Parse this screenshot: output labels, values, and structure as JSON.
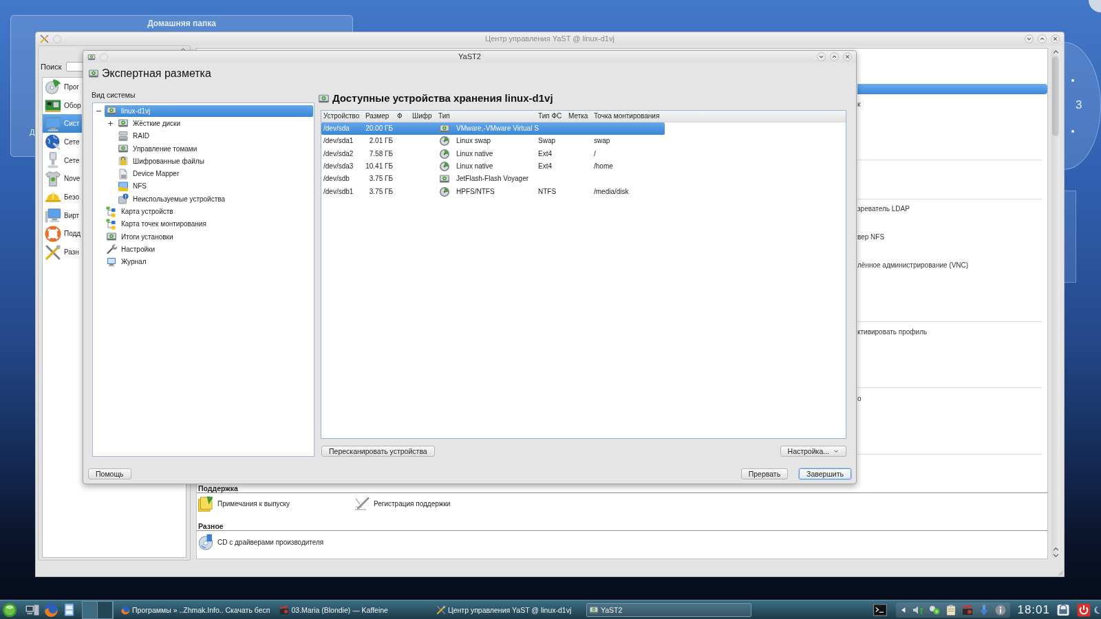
{
  "desktop": {
    "folder_view": {
      "title": "Домашняя папка",
      "items": [
        {
          "label": "Д"
        }
      ]
    },
    "pager": {
      "label": "3"
    }
  },
  "control_center": {
    "title": "Центр управления YaST @ linux-d1vj",
    "search": {
      "label": "Поиск"
    },
    "categories": [
      {
        "label": "Прог",
        "selected": false
      },
      {
        "label": "Обор",
        "selected": false
      },
      {
        "label": "Сист",
        "selected": true
      },
      {
        "label": "Сете",
        "selected": false
      },
      {
        "label": "Сете",
        "selected": false
      },
      {
        "label": "Nove",
        "selected": false
      },
      {
        "label": "Безо",
        "selected": false
      },
      {
        "label": "Вирт",
        "selected": false
      },
      {
        "label": "Подд",
        "selected": false
      },
      {
        "label": "Разн",
        "selected": false
      }
    ],
    "module_column": {
      "header_selected": true,
      "entries": [
        "к",
        "зреватель LDAP",
        "вер NFS",
        "лённое администрирование (VNC)",
        "ктивировать профиль",
        "о"
      ]
    },
    "groups": [
      {
        "heading": "Поддержка",
        "modules": [
          "Примечания к выпуску",
          "Регистрация поддержки"
        ]
      },
      {
        "heading": "Разное",
        "modules": [
          "CD с драйверами производителя"
        ]
      }
    ]
  },
  "dialog": {
    "title": "YaST2",
    "heading": "Экспертная разметка",
    "tree_label": "Вид системы",
    "tree": [
      {
        "label": "linux-d1vj",
        "selected": true,
        "expanded": true,
        "children": [
          {
            "label": "Жёсткие диски",
            "selected": false,
            "expanded": false
          },
          {
            "label": "RAID",
            "selected": false
          },
          {
            "label": "Управление томами",
            "selected": false
          },
          {
            "label": "Шифрованные файлы",
            "selected": false
          },
          {
            "label": "Device Mapper",
            "selected": false
          },
          {
            "label": "NFS",
            "selected": false
          },
          {
            "label": "Неиспользуемые устройства",
            "selected": false
          }
        ]
      },
      {
        "label": "Карта устройств",
        "selected": false
      },
      {
        "label": "Карта точек монтирования",
        "selected": false
      },
      {
        "label": "Итоги установки",
        "selected": false
      },
      {
        "label": "Настройки",
        "selected": false
      },
      {
        "label": "Журнал",
        "selected": false
      }
    ],
    "panel_title": "Доступные устройства хранения linux-d1vj",
    "table": {
      "columns": [
        "Устройство",
        "Размер",
        "Ф",
        "Шифр",
        "Тип",
        "Тип ФС",
        "Метка",
        "Точка монтирования"
      ],
      "rows": [
        {
          "kind": "disk",
          "selected": true,
          "device": "/dev/sda",
          "size": "20.00 ГБ",
          "type": "VMware,-VMware Virtual S"
        },
        {
          "kind": "partition",
          "selected": false,
          "device": "/dev/sda1",
          "size": "2.01 ГБ",
          "type": "Linux swap",
          "fs_type": "Swap",
          "mount_point": "swap"
        },
        {
          "kind": "partition",
          "selected": false,
          "device": "/dev/sda2",
          "size": "7.58 ГБ",
          "type": "Linux native",
          "fs_type": "Ext4",
          "mount_point": "/"
        },
        {
          "kind": "partition",
          "selected": false,
          "device": "/dev/sda3",
          "size": "10.41 ГБ",
          "type": "Linux native",
          "fs_type": "Ext4",
          "mount_point": "/home"
        },
        {
          "kind": "disk",
          "selected": false,
          "device": "/dev/sdb",
          "size": "3.75 ГБ",
          "type": "JetFlash-Flash Voyager"
        },
        {
          "kind": "partition",
          "selected": false,
          "device": "/dev/sdb1",
          "size": "3.75 ГБ",
          "type": "HPFS/NTFS",
          "fs_type": "NTFS",
          "mount_point": "/media/disk"
        }
      ]
    },
    "rescan_button": "Пересканировать устройства",
    "settings_button": "Настройка...",
    "help_button": "Помощь",
    "footer_buttons": [
      {
        "label": "Прервать",
        "default": false
      },
      {
        "label": "Завершить",
        "default": true
      }
    ]
  },
  "taskbar": {
    "tasks": [
      {
        "label": "Программы » ..Zhmak.Info.. Скачать бесп",
        "selected": false
      },
      {
        "label": "03.Maria (Blondie) — Kaffeine",
        "selected": false
      },
      {
        "label": "Центр управления YaST @ linux-d1vj",
        "selected": false
      },
      {
        "label": "YaST2",
        "selected": true
      }
    ],
    "clock": "18:01"
  }
}
